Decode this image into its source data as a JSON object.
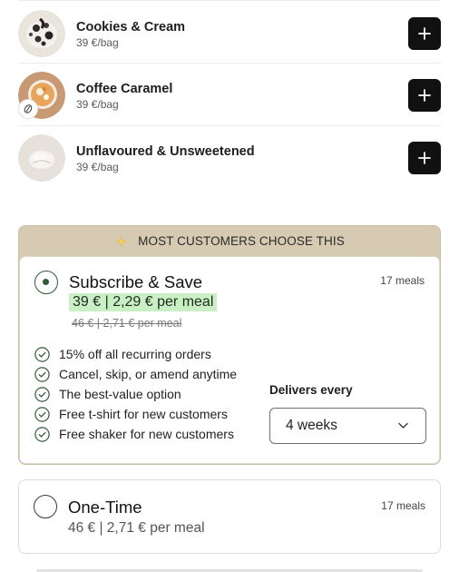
{
  "flavours": [
    {
      "name": "Cookies & Cream",
      "price": "39 €/bag",
      "image_icon": "cookies-cream-powder-icon"
    },
    {
      "name": "Coffee Caramel",
      "price": "39 €/bag",
      "image_icon": "coffee-caramel-drink-icon",
      "badge_icon": "coffee-bean-icon"
    },
    {
      "name": "Unflavoured & Unsweetened",
      "price": "39 €/bag",
      "image_icon": "plain-powder-icon"
    }
  ],
  "add_button_icon": "plus-icon",
  "subscribe": {
    "banner": "MOST CUSTOMERS CHOOSE THIS",
    "banner_icon": "sparkle-icon",
    "title": "Subscribe & Save",
    "meals": "17 meals",
    "price": "39 € | 2,29 € per meal",
    "old_price": "46 € | 2,71 € per meal",
    "benefits": [
      "15% off all recurring orders",
      "Cancel, skip, or amend anytime",
      "The best-value option",
      "Free t-shirt for new customers",
      "Free shaker for new customers"
    ],
    "delivers_label": "Delivers every",
    "delivery_frequency": "4 weeks",
    "selected": true
  },
  "one_time": {
    "title": "One-Time",
    "meals": "17 meals",
    "price": "46 € | 2,71 € per meal",
    "selected": false
  },
  "colors": {
    "banner_bg": "#d6cbb2",
    "price_highlight": "#c9efc4",
    "add_button": "#111111",
    "radio_selected": "#2e5a3a"
  }
}
